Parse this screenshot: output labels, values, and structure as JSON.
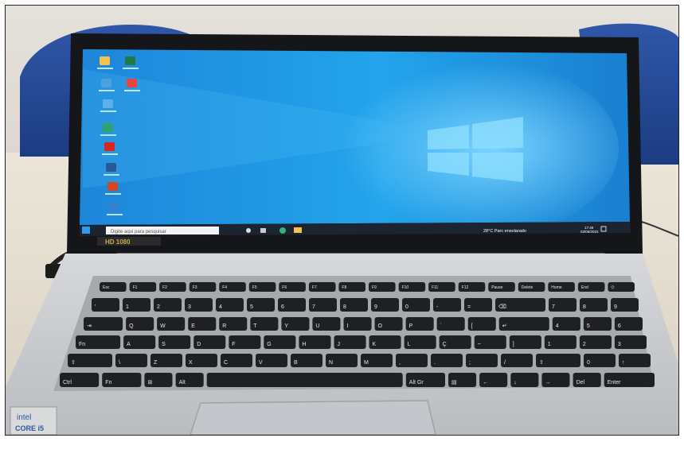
{
  "scene": {
    "search_placeholder": "Digite aqui para pesquisar",
    "weather_text": "28°C Parc ensolarado",
    "clock_time": "17:48",
    "clock_date": "03/06/2022",
    "badge_text": "HD 1080",
    "sticker_brand": "intel",
    "sticker_model": "CORE i5",
    "desktop_icons": [
      {
        "name": "user-folder-icon",
        "color": "#f2c14e"
      },
      {
        "name": "excel-icon",
        "color": "#1f7a45"
      },
      {
        "name": "network-icon",
        "color": "#4aa3df"
      },
      {
        "name": "chrome-icon",
        "color": "#e8453c"
      },
      {
        "name": "pc-icon",
        "color": "#5db0ea"
      },
      {
        "name": "edge-icon",
        "color": "#2fa36b"
      },
      {
        "name": "acrobat-icon",
        "color": "#d7261e"
      },
      {
        "name": "word-icon",
        "color": "#2b5797"
      },
      {
        "name": "powerpoint-icon",
        "color": "#d24726"
      },
      {
        "name": "app-icon",
        "color": "#3b7fd1"
      }
    ],
    "key_rows": [
      [
        "Esc",
        "F1",
        "F2",
        "F3",
        "F4",
        "F5",
        "F6",
        "F7",
        "F8",
        "F9",
        "F10",
        "F11",
        "F12",
        "Pause",
        "Delete",
        "Home",
        "End",
        "⏻"
      ],
      [
        "'",
        "1",
        "2",
        "3",
        "4",
        "5",
        "6",
        "7",
        "8",
        "9",
        "0",
        "-",
        "=",
        "⌫",
        "7",
        "8",
        "9"
      ],
      [
        "⇥",
        "Q",
        "W",
        "E",
        "R",
        "T",
        "Y",
        "U",
        "I",
        "O",
        "P",
        "´",
        "[",
        "↵",
        "4",
        "5",
        "6"
      ],
      [
        "Fn",
        "A",
        "S",
        "D",
        "F",
        "G",
        "H",
        "J",
        "K",
        "L",
        "Ç",
        "~",
        "]",
        "1",
        "2",
        "3"
      ],
      [
        "⇧",
        "\\",
        "Z",
        "X",
        "C",
        "V",
        "B",
        "N",
        "M",
        ",",
        ".",
        ";",
        "/",
        "⇧",
        "0",
        "↑"
      ],
      [
        "Ctrl",
        "Fn",
        "⊞",
        "Alt",
        "",
        "Alt Gr",
        "▤",
        "←",
        "↓",
        "→",
        "Del",
        "Enter"
      ]
    ]
  }
}
